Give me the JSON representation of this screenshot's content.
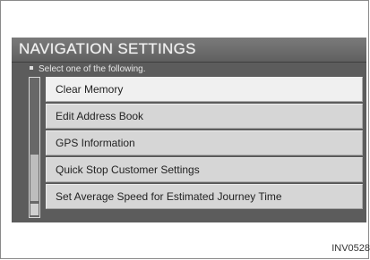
{
  "screen": {
    "title": "NAVIGATION SETTINGS",
    "instruction": "Select one of the following.",
    "menu_items": [
      {
        "label": "Clear Memory",
        "selected": true
      },
      {
        "label": "Edit Address Book",
        "selected": false
      },
      {
        "label": "GPS Information",
        "selected": false
      },
      {
        "label": "Quick Stop Customer Settings",
        "selected": false
      },
      {
        "label": "Set Average Speed for Estimated Journey Time",
        "selected": false
      }
    ]
  },
  "figure_code": "INV0528"
}
